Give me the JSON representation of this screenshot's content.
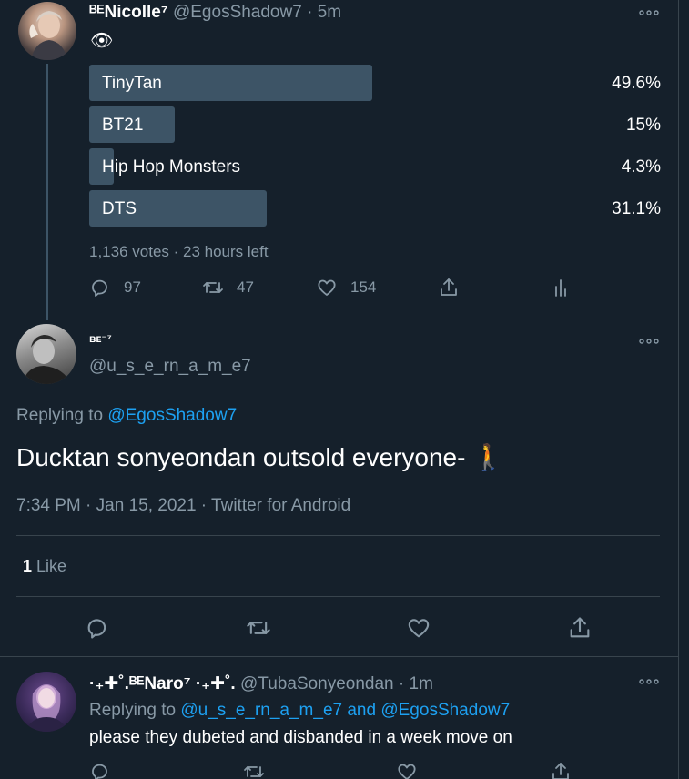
{
  "tweet1": {
    "display_name": "ᴮᴱNicolle⁷",
    "handle": "@EgosShadow7",
    "time": "· 5m",
    "emoji": "👁",
    "poll": {
      "options": [
        {
          "label": "TinyTan",
          "percent": "49.6%",
          "value": 49.6
        },
        {
          "label": "BT21",
          "percent": "15%",
          "value": 15
        },
        {
          "label": "Hip Hop Monsters",
          "percent": "4.3%",
          "value": 4.3
        },
        {
          "label": "DTS",
          "percent": "31.1%",
          "value": 31.1
        }
      ],
      "meta": "1,136 votes · 23 hours left"
    },
    "actions": {
      "replies": "97",
      "retweets": "47",
      "likes": "154"
    }
  },
  "tweet2": {
    "display_name": "ʙᴇ⁻⁷",
    "handle": "@u_s_e_rn_a_m_e7",
    "replying_prefix": "Replying to ",
    "replying_to": "@EgosShadow7",
    "text": "Ducktan sonyeondan outsold everyone- 🚶",
    "meta": "7:34 PM · Jan 15, 2021 · Twitter for Android",
    "like_count": "1",
    "like_label": "Like"
  },
  "tweet3": {
    "display_name": "·₊✚˚.ᴮᴱNaro⁷ ·₊✚˚.",
    "handle": "@TubaSonyeondan",
    "time": "· 1m",
    "replying_prefix": "Replying to ",
    "replying_to": "@u_s_e_rn_a_m_e7 and @EgosShadow7",
    "text": "please they dubeted and disbanded in a week move on"
  },
  "colors": {
    "background": "#15202b",
    "accent": "#1da1f2",
    "muted": "#8899a6",
    "poll_bar": "#3d5466",
    "divider": "#38444d"
  }
}
